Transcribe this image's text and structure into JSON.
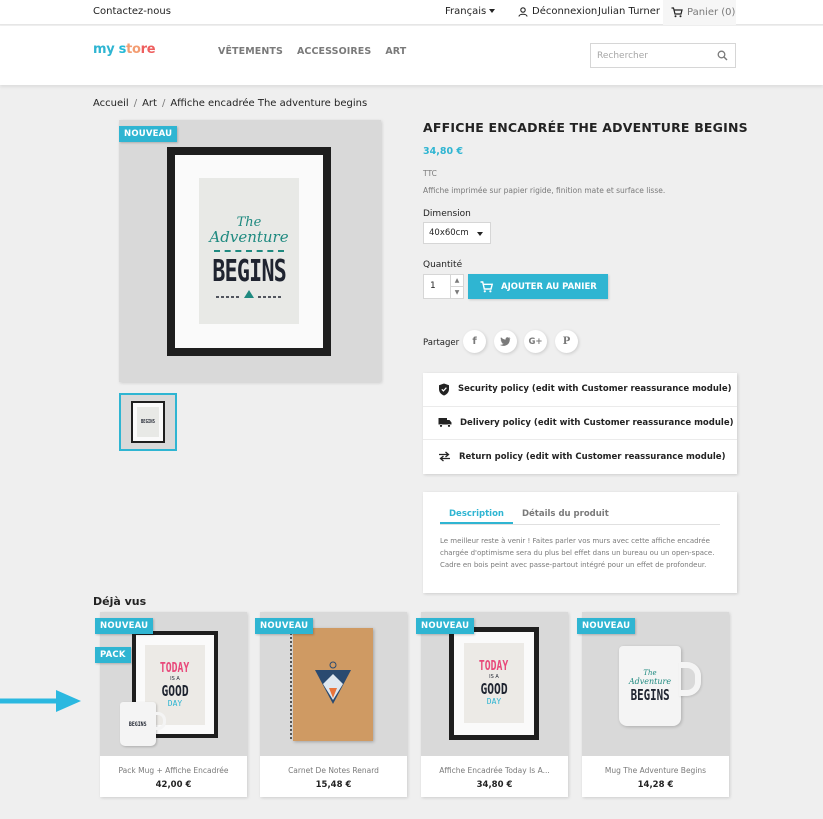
{
  "topbar": {
    "contact": "Contactez-nous",
    "language": "Français",
    "login": "Déconnexion",
    "user": "Julian Turner",
    "cart": "Panier (0)"
  },
  "header": {
    "logo": {
      "part1": "my",
      "part2": "s",
      "part3": "to",
      "part4": "re"
    },
    "nav": [
      "VÊTEMENTS",
      "ACCESSOIRES",
      "ART"
    ],
    "search_placeholder": "Rechercher"
  },
  "breadcrumb": [
    "Accueil",
    "Art",
    "Affiche encadrée The adventure begins"
  ],
  "product": {
    "flag": "NOUVEAU",
    "title": "AFFICHE ENCADRÉE THE ADVENTURE BEGINS",
    "price": "34,80 €",
    "tax_label": "TTC",
    "short_description": "Affiche imprimée sur papier rigide, finition mate et surface lisse.",
    "dimension_label": "Dimension",
    "dimension_value": "40x60cm",
    "quantity_label": "Quantité",
    "quantity_value": "1",
    "add_to_cart": "AJOUTER AU PANIER",
    "share_label": "Partager",
    "share_icons": [
      "f",
      "t",
      "G+",
      "P"
    ],
    "poster_text": {
      "line1": "The",
      "line2": "Adventure",
      "line3": "BEGINS"
    }
  },
  "reassurance": [
    {
      "icon": "shield-icon",
      "label": "Security policy (edit with Customer reassurance module)"
    },
    {
      "icon": "truck-icon",
      "label": "Delivery policy (edit with Customer reassurance module)"
    },
    {
      "icon": "swap-icon",
      "label": "Return policy (edit with Customer reassurance module)"
    }
  ],
  "tabs": {
    "items": [
      "Description",
      "Détails du produit"
    ],
    "active": "Description",
    "description_lines": [
      "Le meilleur reste à venir ! Faites parler vos murs avec cette affiche encadrée",
      "chargée d'optimisme sera du plus bel effet dans un bureau ou un open-space.",
      "Cadre en bois peint avec passe-partout intégré pour un effet de profondeur."
    ]
  },
  "already_seen": {
    "title": "Déjà vus",
    "products": [
      {
        "name": "Pack Mug + Affiche Encadrée",
        "price": "42,00 €",
        "flags": [
          "NOUVEAU",
          "PACK"
        ]
      },
      {
        "name": "Carnet De Notes Renard",
        "price": "15,48 €",
        "flags": [
          "NOUVEAU"
        ]
      },
      {
        "name": "Affiche Encadrée Today Is A...",
        "price": "34,80 €",
        "flags": [
          "NOUVEAU"
        ]
      },
      {
        "name": "Mug The Adventure Begins",
        "price": "14,28 €",
        "flags": [
          "NOUVEAU"
        ]
      }
    ],
    "poster_text": {
      "line1": "TODAY",
      "line2": "IS A",
      "line3": "GOOD",
      "line4": "DAY"
    }
  },
  "colors": {
    "accent": "#2fb5d2",
    "annotation_arrow": "#2bb8e0"
  }
}
